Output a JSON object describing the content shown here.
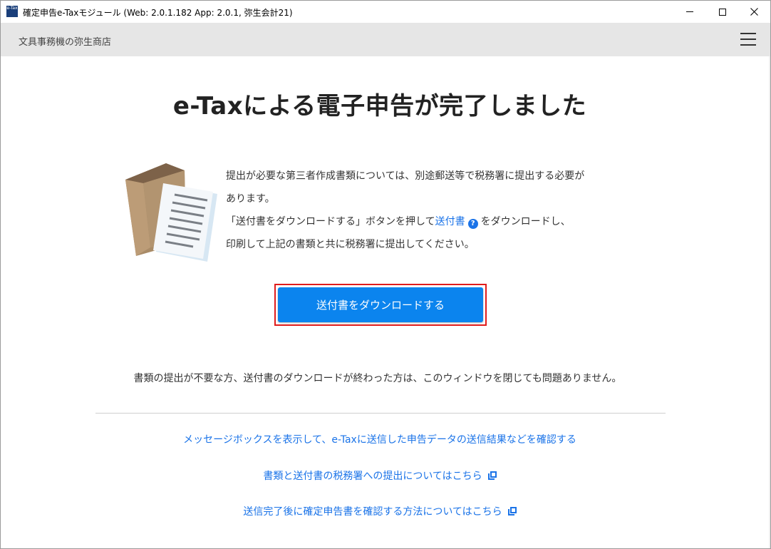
{
  "window": {
    "title": "確定申告e-Taxモジュール (Web: 2.0.1.182 App: 2.0.1, 弥生会計21)",
    "icon_label": "e-Tax",
    "minimize_icon": "minimize-icon",
    "maximize_icon": "maximize-icon",
    "close_icon": "close-icon"
  },
  "header": {
    "company_name": "文具事務機の弥生商店",
    "menu_icon": "hamburger-menu-icon"
  },
  "main": {
    "title": "e-Taxによる電子申告が完了しました",
    "instructions": {
      "line1": "提出が必要な第三者作成書類については、別途郵送等で税務署に提出する必要が",
      "line2": "あります。",
      "line3_pre": "「送付書をダウンロードする」ボタンを押して",
      "line3_link": "送付書",
      "line3_help": "?",
      "line3_post": "をダウンロードし、",
      "line4": "印刷して上記の書類と共に税務署に提出してください。"
    },
    "download_button": "送付書をダウンロードする",
    "note": "書類の提出が不要な方、送付書のダウンロードが終わった方は、このウィンドウを閉じても問題ありません。",
    "links": [
      "メッセージボックスを表示して、e-Taxに送信した申告データの送信結果などを確認する",
      "書類と送付書の税務署への提出についてはこちら",
      "送信完了後に確定申告書を確認する方法についてはこちら"
    ]
  },
  "colors": {
    "accent": "#0b84ee",
    "link": "#1a73e8",
    "highlight_border": "#e01c1c",
    "header_bg": "#e6e6e6"
  }
}
